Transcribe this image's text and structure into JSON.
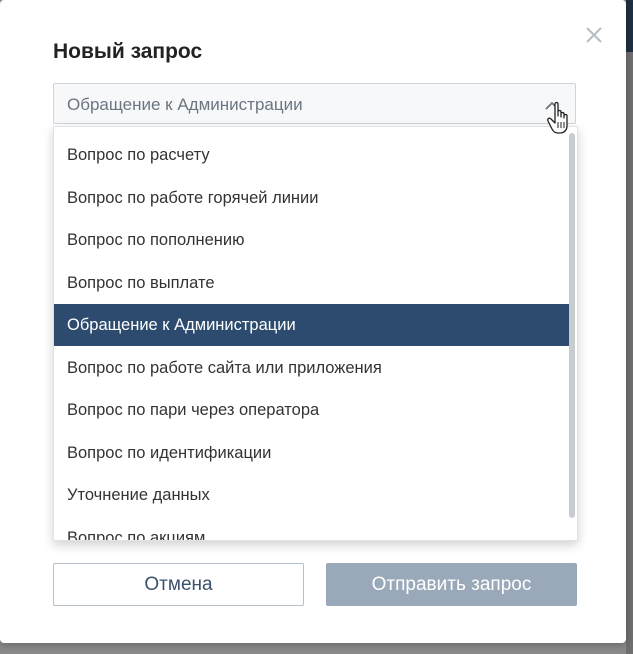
{
  "modal": {
    "title": "Новый запрос",
    "close_icon": "close-icon"
  },
  "select": {
    "value": "Обращение к Администрации",
    "icon": "chevron-up-icon"
  },
  "dropdown": {
    "options": [
      {
        "label": "Вопрос по расчету",
        "selected": false
      },
      {
        "label": "Вопрос по работе горячей линии",
        "selected": false
      },
      {
        "label": "Вопрос по пополнению",
        "selected": false
      },
      {
        "label": "Вопрос по выплате",
        "selected": false
      },
      {
        "label": "Обращение к Администрации",
        "selected": true
      },
      {
        "label": "Вопрос по работе сайта или приложения",
        "selected": false
      },
      {
        "label": "Вопрос по пари через оператора",
        "selected": false
      },
      {
        "label": "Вопрос по идентификации",
        "selected": false
      },
      {
        "label": "Уточнение данных",
        "selected": false
      },
      {
        "label": "Вопрос по акциям",
        "selected": false
      }
    ]
  },
  "buttons": {
    "cancel_label": "Отмена",
    "submit_label": "Отправить запрос"
  },
  "colors": {
    "selected_bg": "#2d4b6e",
    "submit_bg": "#9aa9ba",
    "cancel_text": "#3b526b"
  }
}
